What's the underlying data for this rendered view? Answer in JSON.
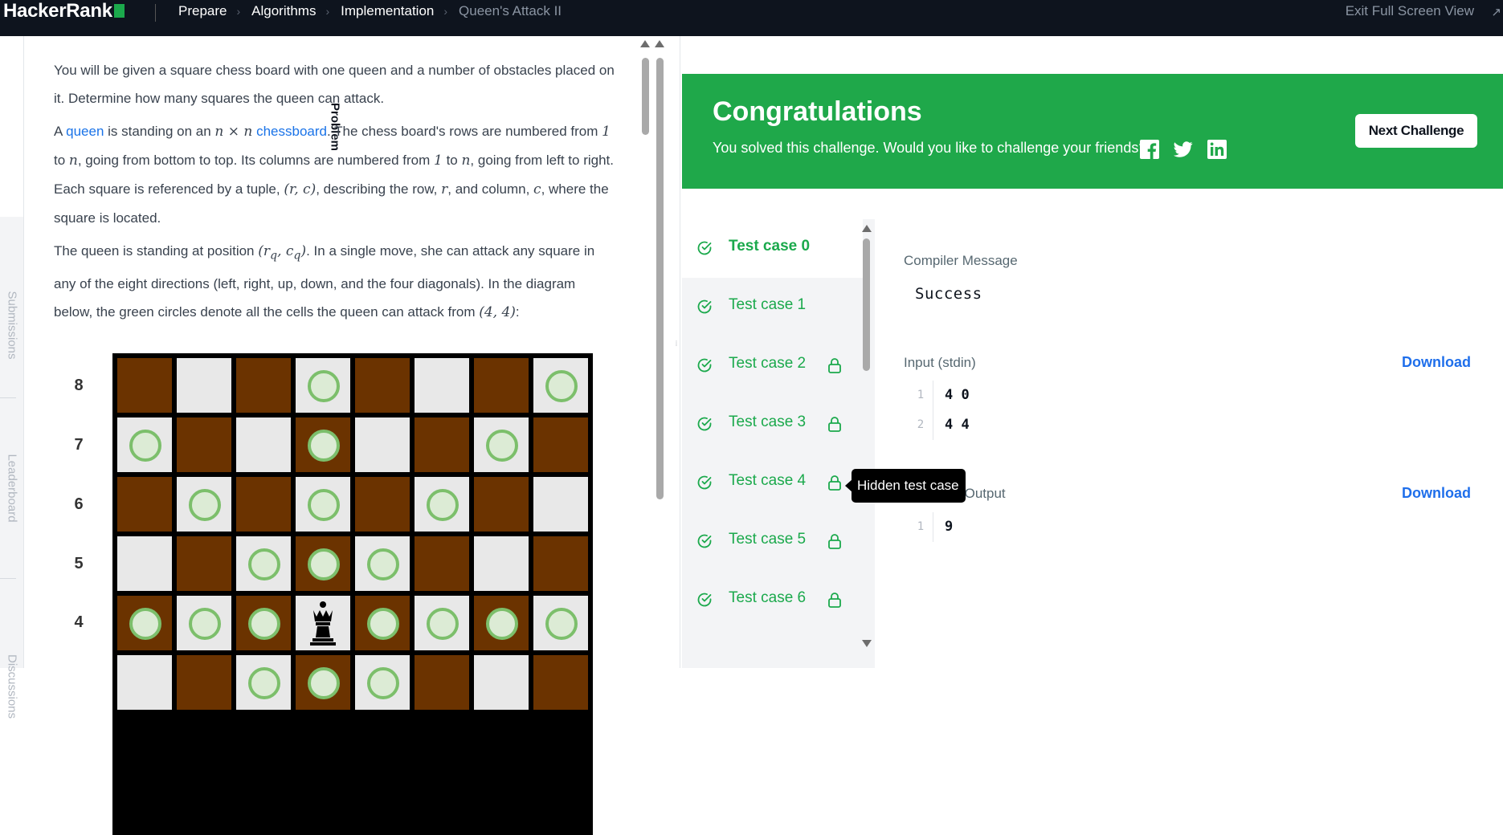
{
  "header": {
    "logo_text": "HackerRank",
    "breadcrumbs": [
      "Prepare",
      "Algorithms",
      "Implementation",
      "Queen's Attack II"
    ],
    "exit_fullscreen": "Exit Full Screen View",
    "icons": {
      "breadcrumb_separator": "chevron-right-icon",
      "exit": "arrow-diagonal-icon"
    }
  },
  "side_tabs": [
    "Problem",
    "Submissions",
    "Leaderboard",
    "Discussions"
  ],
  "problem": {
    "p1": "You will be given a square chess board with one queen and a number of obstacles placed on it. Determine how many squares the queen can attack.",
    "p2": {
      "t1": "A ",
      "link1": "queen",
      "t2": " is standing on an ",
      "m1": "n × n",
      "t3": " ",
      "link2": "chessboard",
      "t4": ". The chess board's rows are numbered from ",
      "m2": "1",
      "t5": " to ",
      "m3": "n",
      "t6": ", going from bottom to top. Its columns are numbered from ",
      "m4": "1",
      "t7": " to ",
      "m5": "n",
      "t8": ", going from left to right. Each square is referenced by a tuple, ",
      "m6": "(r, c)",
      "t9": ", describing the row, ",
      "m7": "r",
      "t10": ", and column, ",
      "m8": "c",
      "t11": ", where the square is located."
    },
    "p3": {
      "t1": "The queen is standing at position ",
      "m1": "(r",
      "m1_sub1": "q",
      "m1_mid": ", c",
      "m1_sub2": "q",
      "m1_end": ")",
      "t2": ". In a single move, she can attack any square in any of the eight directions (left, right, up, down, and the four diagonals). In the diagram below, the green circles denote all the cells the queen can attack from ",
      "m2": "(4, 4)",
      "t3": ":"
    }
  },
  "board": {
    "ranks": [
      "8",
      "7",
      "6",
      "5",
      "4"
    ],
    "queen_row": 4,
    "queen_col": 4,
    "queen_icon": "chess-queen-icon",
    "colors": {
      "dark": "#6b3300",
      "light": "#e8e8e8",
      "ring": "#7cbf6b"
    }
  },
  "banner": {
    "title": "Congratulations",
    "subtitle": "You solved this challenge. Would you like to challenge your friends?",
    "next_button": "Next Challenge",
    "social_icons": [
      "facebook-icon",
      "twitter-icon",
      "linkedin-icon"
    ],
    "color": "#1fa84a"
  },
  "test_cases": [
    {
      "label": "Test case 0",
      "locked": false,
      "active": true
    },
    {
      "label": "Test case 1",
      "locked": false,
      "active": false
    },
    {
      "label": "Test case 2",
      "locked": true,
      "active": false
    },
    {
      "label": "Test case 3",
      "locked": true,
      "active": false
    },
    {
      "label": "Test case 4",
      "locked": true,
      "active": false
    },
    {
      "label": "Test case 5",
      "locked": true,
      "active": false
    },
    {
      "label": "Test case 6",
      "locked": true,
      "active": false
    }
  ],
  "tooltip": "Hidden test case",
  "result": {
    "compiler_label": "Compiler Message",
    "compiler_message": "Success",
    "input_label": "Input (stdin)",
    "input_lines": [
      "4 0",
      "4 4"
    ],
    "output_label": "Expected Output",
    "output_lines": [
      "9"
    ],
    "download_label": "Download"
  }
}
